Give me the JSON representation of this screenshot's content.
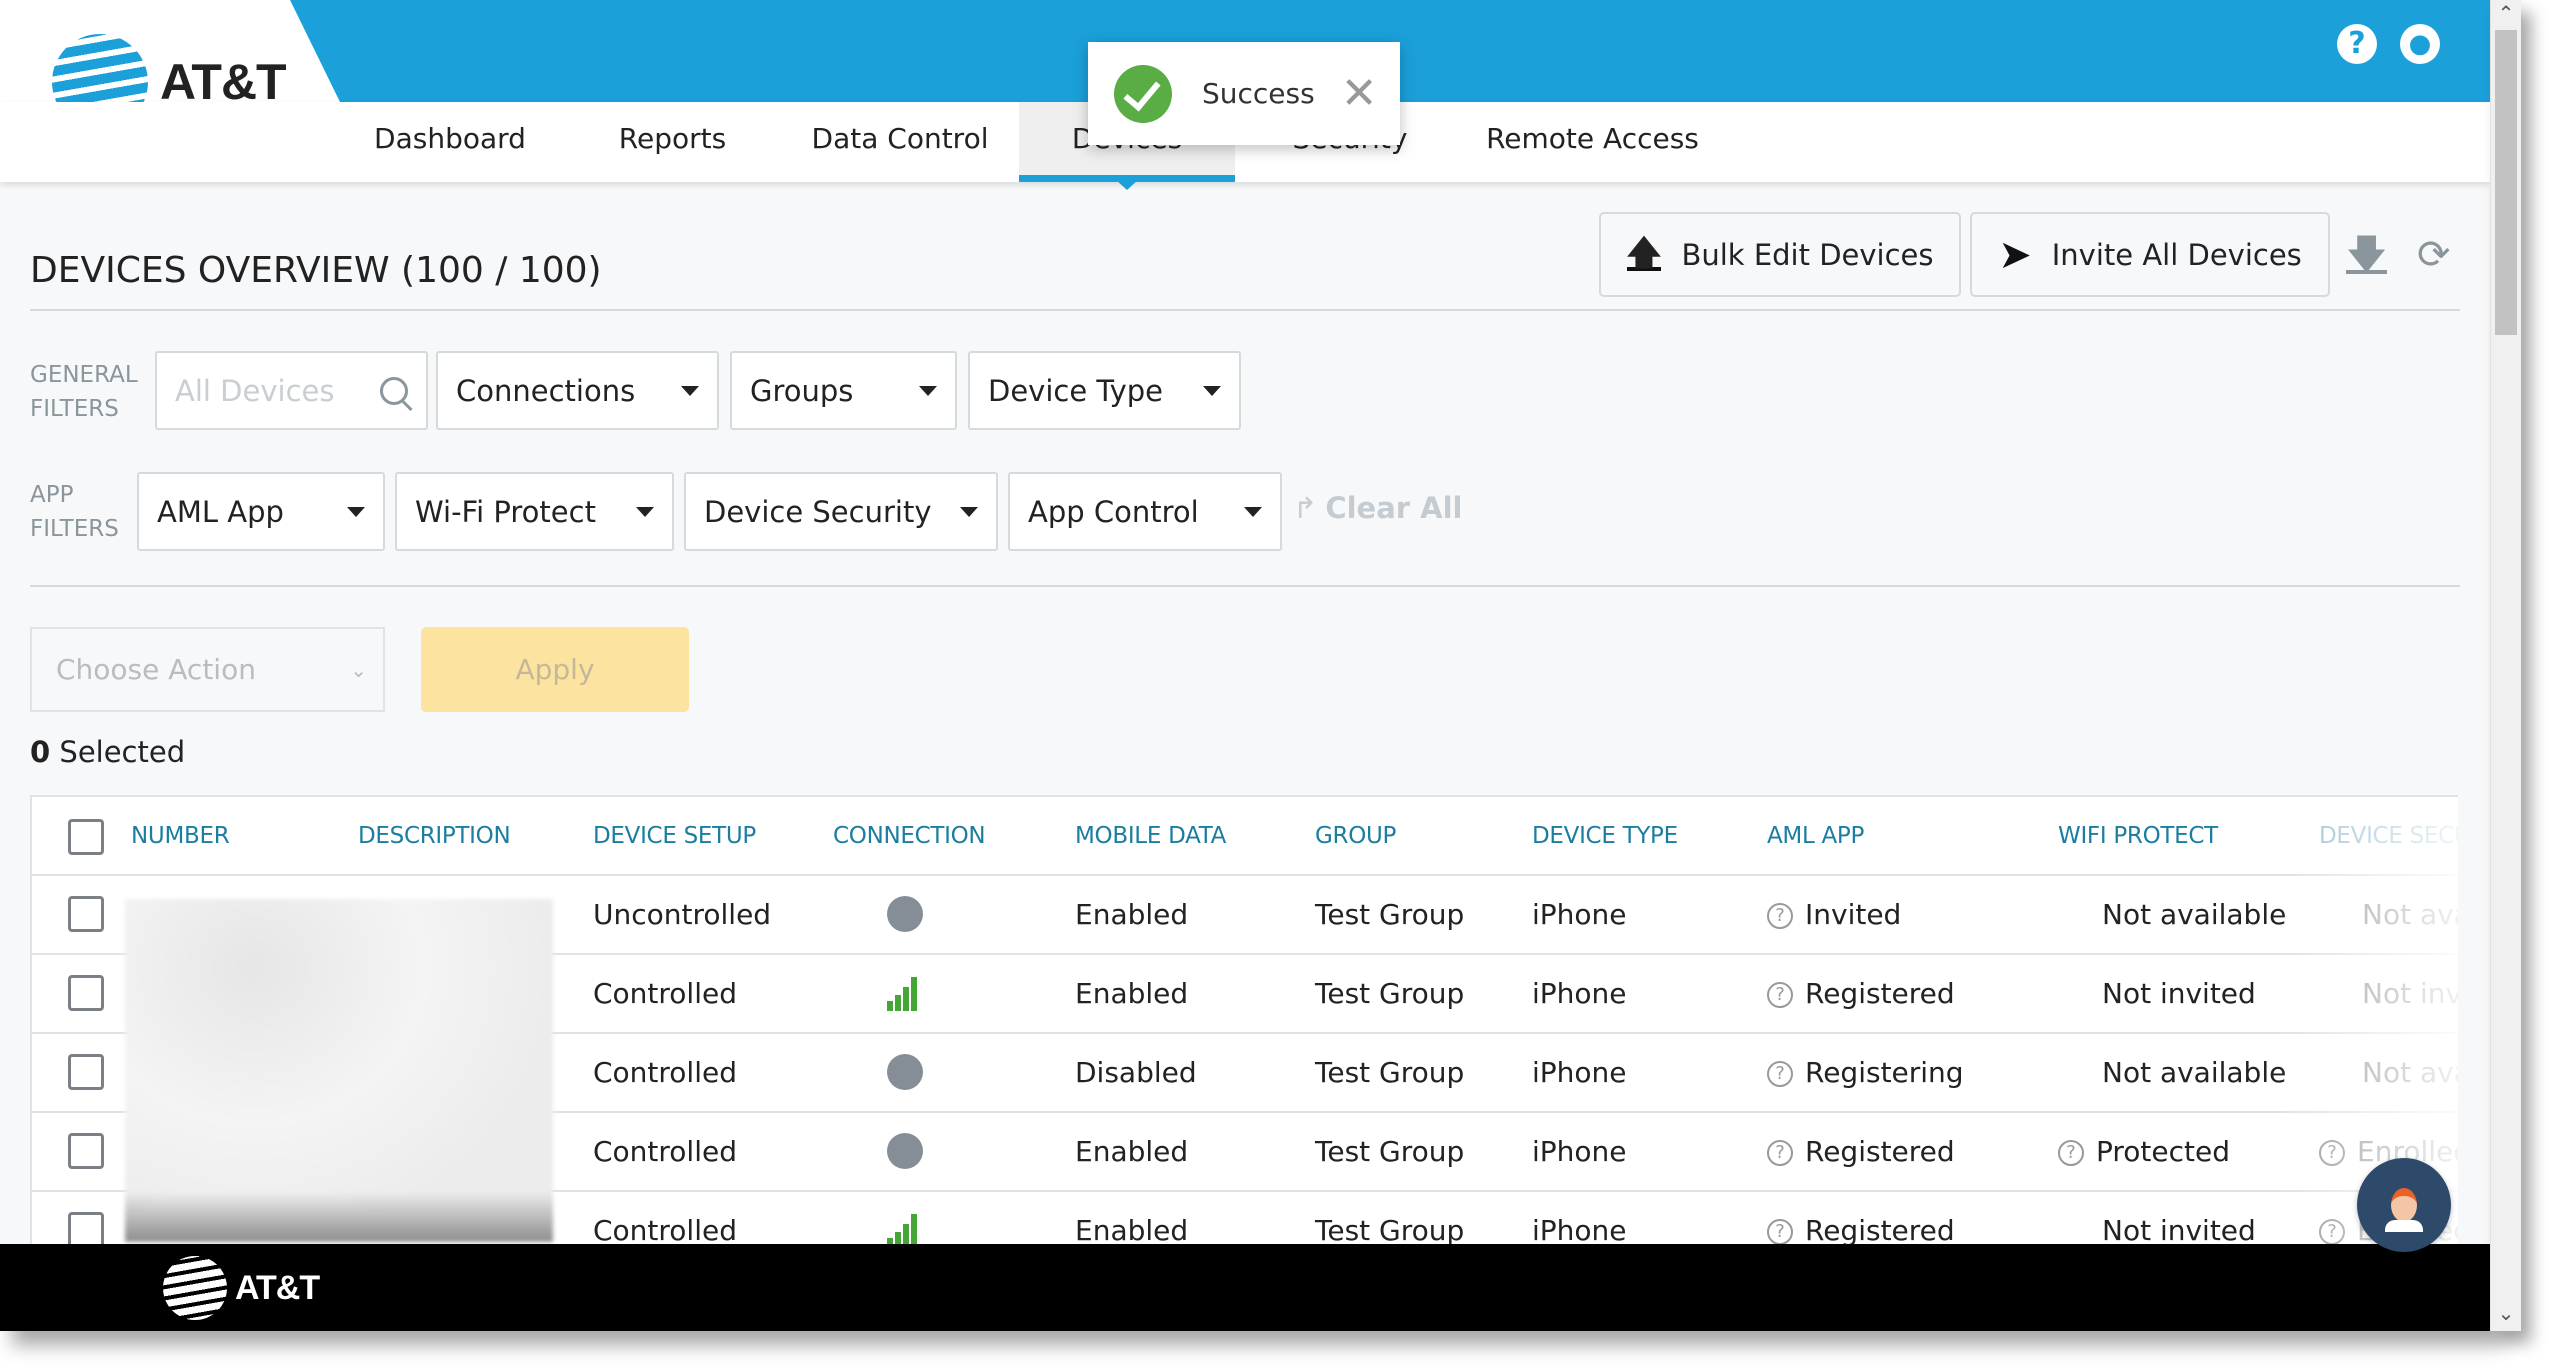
{
  "brand": {
    "name": "AT&T",
    "color": "#1ba0da"
  },
  "header": {
    "help_icon": "help-circle-icon",
    "user_icon": "user-account-icon"
  },
  "nav": {
    "tabs": [
      {
        "label": "Dashboard",
        "active": false
      },
      {
        "label": "Reports",
        "active": false
      },
      {
        "label": "Data Control",
        "active": false
      },
      {
        "label": "Devices",
        "active": true
      },
      {
        "label": "Security",
        "active": false
      },
      {
        "label": "Remote Access",
        "active": false
      }
    ]
  },
  "toast": {
    "message": "Success",
    "icon": "check-circle-icon",
    "close_icon": "close-icon"
  },
  "page": {
    "title": "DEVICES OVERVIEW (100 / 100)",
    "bulk_edit_label": "Bulk Edit Devices",
    "invite_all_label": "Invite All Devices",
    "download_icon": "download-icon",
    "refresh_icon": "refresh-icon"
  },
  "filters": {
    "general_label_1": "GENERAL",
    "general_label_2": "FILTERS",
    "search_placeholder": "All Devices",
    "general": [
      "Connections",
      "Groups",
      "Device Type"
    ],
    "app_label_1": "APP",
    "app_label_2": "FILTERS",
    "app": [
      "AML App",
      "Wi-Fi Protect",
      "Device Security",
      "App Control"
    ],
    "clear_all": "Clear All"
  },
  "actions": {
    "choose_action_placeholder": "Choose Action",
    "apply_label": "Apply",
    "selected_count": "0",
    "selected_label": "Selected"
  },
  "table": {
    "columns": [
      "NUMBER",
      "DESCRIPTION",
      "DEVICE SETUP",
      "CONNECTION",
      "MOBILE DATA",
      "GROUP",
      "DEVICE TYPE",
      "AML APP",
      "WIFI PROTECT",
      "DEVICE SECU"
    ],
    "rows": [
      {
        "number": "",
        "description": "",
        "device_setup": "Uncontrolled",
        "connection": "offline",
        "mobile_data": "Enabled",
        "group": "Test Group",
        "device_type": "iPhone",
        "aml_app": "Invited",
        "wifi_protect": "Not available",
        "wifi_icon": false,
        "device_security": "Not ava",
        "ds_icon": false
      },
      {
        "number": "",
        "description": "",
        "device_setup": "Controlled",
        "connection": "signal",
        "mobile_data": "Enabled",
        "group": "Test Group",
        "device_type": "iPhone",
        "aml_app": "Registered",
        "wifi_protect": "Not invited",
        "wifi_icon": false,
        "device_security": "Not invi",
        "ds_icon": false
      },
      {
        "number": "",
        "description": "",
        "device_setup": "Controlled",
        "connection": "offline",
        "mobile_data": "Disabled",
        "group": "Test Group",
        "device_type": "iPhone",
        "aml_app": "Registering",
        "wifi_protect": "Not available",
        "wifi_icon": false,
        "device_security": "Not ava",
        "ds_icon": false
      },
      {
        "number": "",
        "description": "",
        "device_setup": "Controlled",
        "connection": "offline",
        "mobile_data": "Enabled",
        "group": "Test Group",
        "device_type": "iPhone",
        "aml_app": "Registered",
        "wifi_protect": "Protected",
        "wifi_icon": true,
        "device_security": "Enrolled",
        "ds_icon": true
      },
      {
        "number": "",
        "description": "",
        "device_setup": "Controlled",
        "connection": "signal",
        "mobile_data": "Enabled",
        "group": "Test Group",
        "device_type": "iPhone",
        "aml_app": "Registered",
        "wifi_protect": "Not invited",
        "wifi_icon": false,
        "device_security": "Enrolled",
        "ds_icon": true
      }
    ]
  },
  "footer": {
    "brand": "AT&T"
  },
  "chat": {
    "icon": "chat-assistant-avatar-icon"
  }
}
